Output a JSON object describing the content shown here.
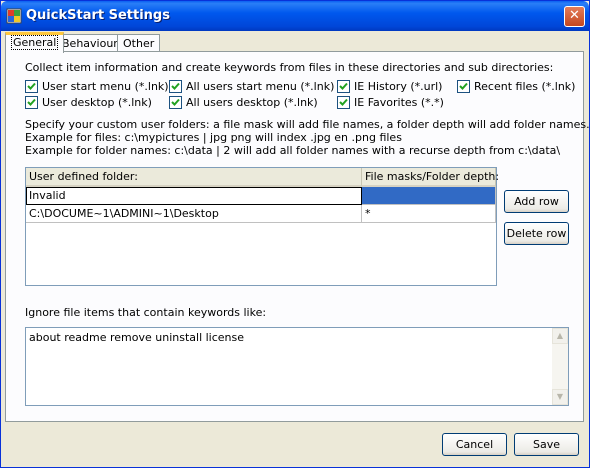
{
  "window": {
    "title": "QuickStart Settings",
    "close_glyph": "✕"
  },
  "tabs": [
    "General",
    "Behaviour",
    "Other"
  ],
  "general": {
    "intro": "Collect item information and create keywords from files in these directories and sub directories:",
    "checkboxes": [
      {
        "label": "User start menu (*.lnk)",
        "checked": true
      },
      {
        "label": "All users start menu (*.lnk)",
        "checked": true
      },
      {
        "label": "IE History (*.url)",
        "checked": true
      },
      {
        "label": "Recent files (*.lnk)",
        "checked": true
      },
      {
        "label": "User desktop (*.lnk)",
        "checked": true
      },
      {
        "label": "All users desktop (*.lnk)",
        "checked": true
      },
      {
        "label": "IE Favorites (*.*)",
        "checked": true
      }
    ],
    "help_lines": [
      "Specify your custom user folders: a file mask will add file names, a folder depth will add folder names.",
      "Example for files: c:\\mypictures | jpg png will index .jpg en .png files",
      "Example for folder names: c:\\data | 2 will add all folder names with a recurse depth from c:\\data\\"
    ],
    "grid": {
      "headers": [
        "User defined folder:",
        "File masks/Folder depth:"
      ],
      "rows": [
        [
          "Invalid",
          ""
        ],
        [
          "C:\\DOCUME~1\\ADMINI~1\\Desktop",
          "*"
        ]
      ]
    },
    "add_row_label": "Add row",
    "delete_row_label": "Delete row",
    "ignore_label": "Ignore file items that contain keywords like:",
    "ignore_value": "about readme remove uninstall license"
  },
  "footer": {
    "cancel_label": "Cancel",
    "save_label": "Save"
  },
  "colors": {
    "titlebar": "#0058ee",
    "selection": "#316ac5",
    "tab_highlight": "#ffc83c"
  }
}
